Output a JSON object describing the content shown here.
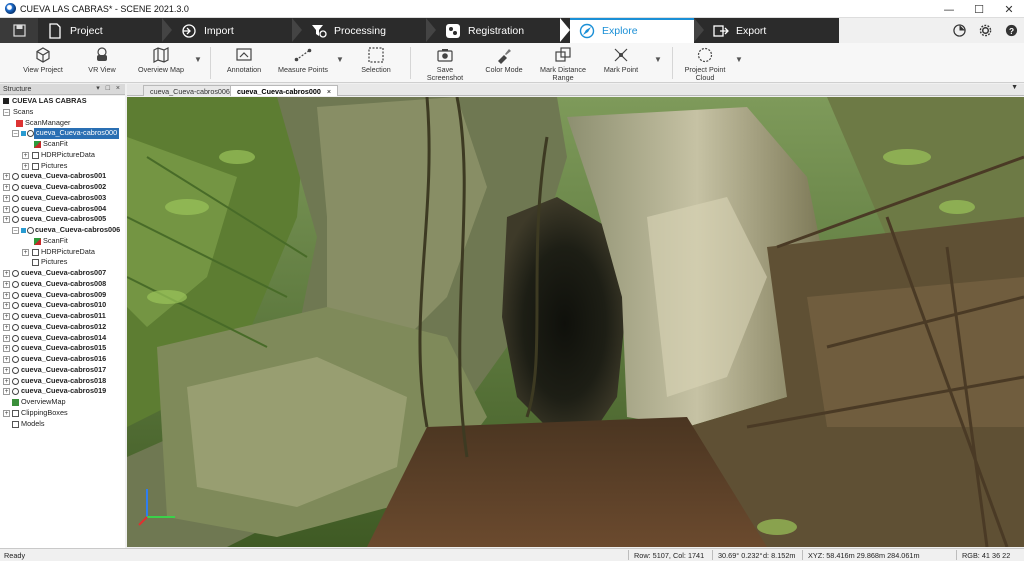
{
  "window": {
    "title": "CUEVA LAS CABRAS* - SCENE 2021.3.0"
  },
  "workflow_tabs": [
    {
      "label": "Project",
      "icon": "document-icon"
    },
    {
      "label": "Import",
      "icon": "import-icon"
    },
    {
      "label": "Processing",
      "icon": "funnel-gear-icon"
    },
    {
      "label": "Registration",
      "icon": "registration-icon"
    },
    {
      "label": "Explore",
      "icon": "explore-icon",
      "active": true
    },
    {
      "label": "Export",
      "icon": "export-icon"
    }
  ],
  "ribbon": {
    "view_project": "View Project",
    "vr_view": "VR View",
    "overview_map": "Overview Map",
    "annotation": "Annotation",
    "measure_points": "Measure Points",
    "selection": "Selection",
    "save_screenshot": "Save Screenshot",
    "color_mode": "Color Mode",
    "mark_distance_range_1": "Mark Distance",
    "mark_distance_range_2": "Range",
    "mark_point": "Mark Point",
    "project_point_cloud_1": "Project Point",
    "project_point_cloud_2": "Cloud"
  },
  "structure": {
    "header": "Structure",
    "root": "CUEVA LAS CABRAS",
    "scans": "Scans",
    "scan_manager": "ScanManager",
    "scan_000": "cueva_Cueva-cabros000",
    "scan_fit": "ScanFit",
    "hdr_picture_data": "HDRPictureData",
    "pictures": "Pictures",
    "scans_list_a": [
      "cueva_Cueva-cabros001",
      "cueva_Cueva-cabros002",
      "cueva_Cueva-cabros003",
      "cueva_Cueva-cabros004",
      "cueva_Cueva-cabros005"
    ],
    "scan_006": "cueva_Cueva-cabros006",
    "scans_list_b": [
      "cueva_Cueva-cabros007",
      "cueva_Cueva-cabros008",
      "cueva_Cueva-cabros009",
      "cueva_Cueva-cabros010",
      "cueva_Cueva-cabros011",
      "cueva_Cueva-cabros012",
      "cueva_Cueva-cabros014",
      "cueva_Cueva-cabros015",
      "cueva_Cueva-cabros016",
      "cueva_Cueva-cabros017",
      "cueva_Cueva-cabros018",
      "cueva_Cueva-cabros019"
    ],
    "overview_map": "OverviewMap",
    "clipping_boxes": "ClippingBoxes",
    "models": "Models"
  },
  "doc_tabs": [
    {
      "label": "cueva_Cueva-cabros006"
    },
    {
      "label": "cueva_Cueva-cabros000",
      "active": true,
      "close": "×"
    }
  ],
  "status": {
    "state": "Ready",
    "row_col": "Row: 5107, Col: 1741",
    "angles": "30.69° 0.232°",
    "distance": "d: 8.152m",
    "xyz": "XYZ: 58.416m 29.868m 284.061m",
    "rgb": "RGB: 41 36 22"
  },
  "colors": {
    "accent": "#1a8fd6",
    "selection": "#2a6fb3",
    "workflow_bg": "#2b2b2b"
  }
}
